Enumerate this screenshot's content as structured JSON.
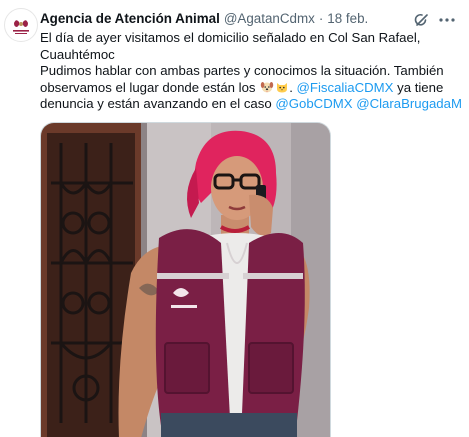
{
  "account": {
    "name": "Agencia de Atención Animal",
    "handle": "@AgatanCdmx",
    "separator": "·",
    "date": "18 feb."
  },
  "icons": {
    "avatar": "agency-logo",
    "grok": "grok-icon",
    "more": "more-dots-icon"
  },
  "tweet": {
    "line1": "El día de ayer visitamos el domicilio señalado en Col San Rafael,",
    "line2": "Cuauhtémoc",
    "line3": "Pudimos hablar con ambas partes y conocimos la situación. También",
    "line4_prefix": "observamos el lugar donde están los ",
    "mention_fiscalia": "@FiscaliaCDMX",
    "line4_suffix": " ya tiene",
    "line5_prefix": "denuncia  y están avanzando en el caso ",
    "mention_gob": "@GobCDMX",
    "mention_clara": "@ClaraBrugadaM",
    "emojis": [
      "dog-face",
      "cat-face"
    ]
  },
  "colors": {
    "link": "#1d9bf0",
    "vest": "#7a1f45",
    "hair": "#e0245e",
    "text": "#0f1419",
    "muted": "#536471"
  }
}
